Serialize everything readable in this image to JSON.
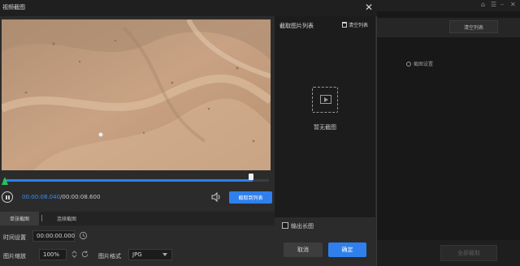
{
  "background_app": {
    "clear_list_label": "清空列表",
    "capture_settings_label": "截图设置",
    "capture_all_label": "全部截取"
  },
  "dialog": {
    "title": "视频截图",
    "close_icon": "close-icon"
  },
  "player": {
    "progress_fraction": 0.94,
    "current_time": "00:00:08.040",
    "separator": "/",
    "total_time": "00:00:08.600",
    "capture_to_list_label": "截取到列表"
  },
  "tabs": [
    {
      "label": "单张截图",
      "active": true
    },
    {
      "label": "连续截图",
      "active": false
    }
  ],
  "settings": {
    "time_label": "时间设置",
    "time_value": "00:00:00.000",
    "zoom_label": "图片缩放",
    "zoom_value": "100%",
    "format_label": "图片格式",
    "format_value": "JPG"
  },
  "panel": {
    "title": "截取图片列表",
    "clear_list_label": "清空列表",
    "empty_text": "暂无截图",
    "long_image_label": "输出长图",
    "long_image_checked": false,
    "cancel_label": "取消",
    "ok_label": "确定"
  },
  "colors": {
    "accent": "#2f80ed",
    "start_marker": "#25c25b",
    "sand": "#c19a78"
  }
}
